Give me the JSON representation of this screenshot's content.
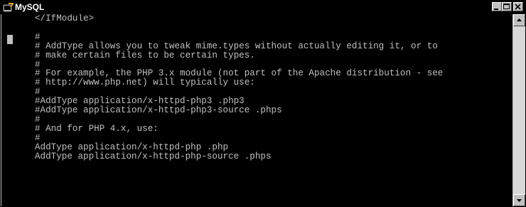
{
  "window": {
    "title": "MySQL",
    "icon": "mysql-console-icon",
    "buttons": [
      "minimize-icon",
      "maximize-icon",
      "close-icon"
    ]
  },
  "terminal": {
    "lines": [
      "</IfModule>",
      "",
      "#",
      "# AddType allows you to tweak mime.types without actually editing it, or to",
      "# make certain files to be certain types.",
      "#",
      "# For example, the PHP 3.x module (not part of the Apache distribution - see",
      "# http://www.php.net) will typically use:",
      "#",
      "#AddType application/x-httpd-php3 .php3",
      "#AddType application/x-httpd-php3-source .phps",
      "#",
      "# And for PHP 4.x, use:",
      "#",
      "AddType application/x-httpd-php .php",
      "AddType application/x-httpd-php-source .phps"
    ]
  },
  "scrollbar": {
    "up_icon": "scroll-up-arrow-icon",
    "down_icon": "scroll-down-arrow-icon"
  },
  "colors": {
    "terminal_background": "#000000",
    "terminal_text": "#c0c0c0",
    "titlebar": "#000000",
    "chrome": "#c0c0c0"
  }
}
